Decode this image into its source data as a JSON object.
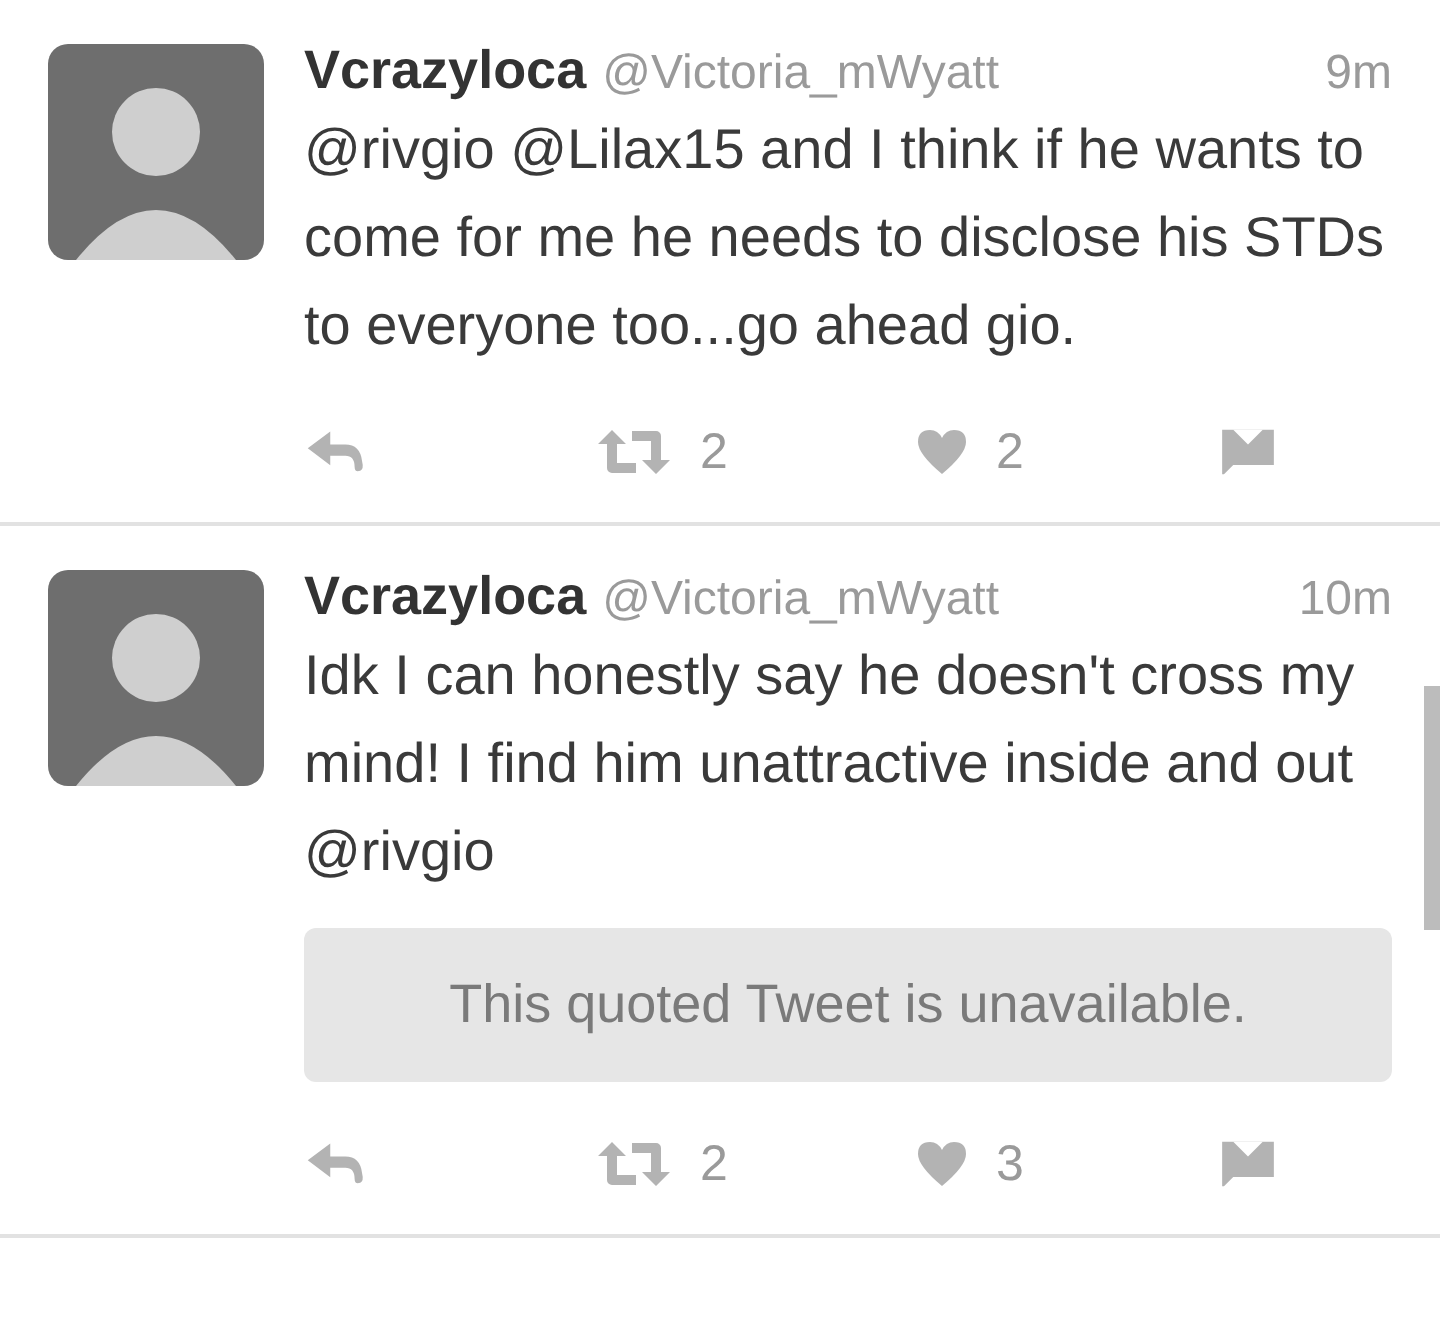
{
  "tweets": [
    {
      "name": "Vcrazyloca",
      "handle": "@Victoria_mWyatt",
      "time": "9m",
      "text": "@rivgio @Lilax15 and I think if he wants to come for me he needs to disclose his STDs to everyone too...go ahead gio.",
      "retweets": "2",
      "likes": "2"
    },
    {
      "name": "Vcrazyloca",
      "handle": "@Victoria_mWyatt",
      "time": "10m",
      "text": "Idk I can honestly say he doesn't cross my mind! I find him unattractive inside and out @rivgio",
      "quote": "This quoted Tweet is unavailable.",
      "retweets": "2",
      "likes": "3"
    }
  ]
}
